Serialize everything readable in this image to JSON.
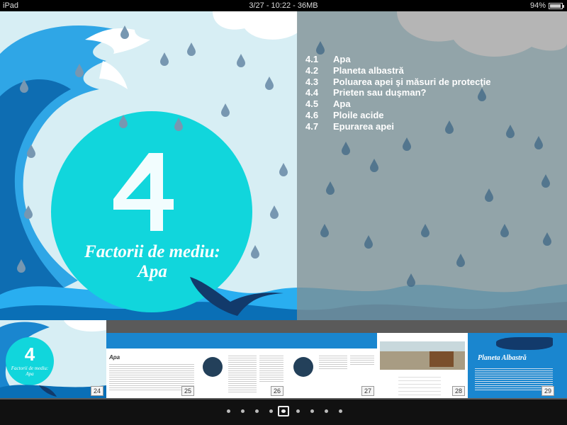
{
  "status_bar": {
    "device": "iPad",
    "info": "3/27 - 10:22 - 36MB",
    "battery": "94%"
  },
  "chapter": {
    "number": "4",
    "title_line1": "Factorii de mediu:",
    "title_line2": "Apa"
  },
  "toc": [
    {
      "num": "4.1",
      "title": "Apa"
    },
    {
      "num": "4.2",
      "title": "Planeta albastră"
    },
    {
      "num": "4.3",
      "title": "Poluarea apei şi măsuri de protecţie"
    },
    {
      "num": "4.4",
      "title": "Prieten sau duşman?"
    },
    {
      "num": "4.5",
      "title": "Apa"
    },
    {
      "num": "4.6",
      "title": "Ploile acide"
    },
    {
      "num": "4.7",
      "title": "Epurarea apei"
    }
  ],
  "thumbnails": [
    {
      "page": "24",
      "caption_line1": "Factorii de mediu:",
      "caption_line2": "Apa"
    },
    {
      "page": "25",
      "heading": "Apa"
    },
    {
      "page": "26"
    },
    {
      "page": "27"
    },
    {
      "page": "28"
    },
    {
      "page": "29",
      "heading": "Planeta Albastră"
    }
  ],
  "pager": {
    "count": 9,
    "active_index": 4
  },
  "colors": {
    "sky": "#d7eef4",
    "overlay": "#8a9ea4",
    "wave_dark": "#0a6fb6",
    "wave_mid": "#29aef0",
    "circle": "#11d6dc",
    "drop": "#7797b1",
    "tail": "#123a6b"
  }
}
